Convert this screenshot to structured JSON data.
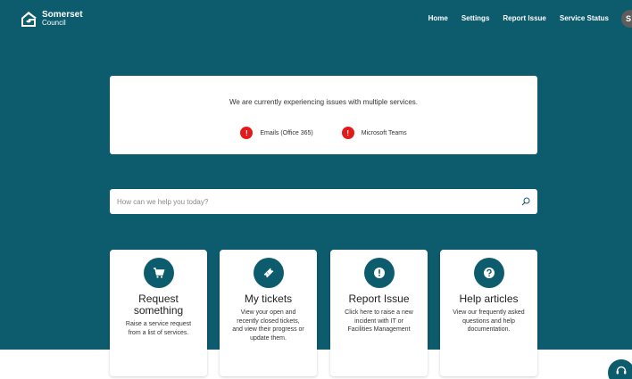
{
  "header": {
    "logo_name": "Somerset",
    "logo_sub": "Council",
    "nav": [
      "Home",
      "Settings",
      "Report Issue",
      "Service Status"
    ],
    "avatar_initials": "S"
  },
  "alert": {
    "message": "We are currently experiencing issues with multiple services.",
    "items": [
      {
        "icon": "!",
        "label": "Emails (Office 365)"
      },
      {
        "icon": "!",
        "label": "Microsoft Teams"
      }
    ]
  },
  "search": {
    "placeholder": "How can we help you today?",
    "value": ""
  },
  "cards": [
    {
      "title": "Request something",
      "desc": "Raise a service request from a list of services.",
      "icon": "cart-icon"
    },
    {
      "title": "My tickets",
      "desc": "View your open and recently closed tickets, and view their progress or update them.",
      "icon": "ticket-icon"
    },
    {
      "title": "Report Issue",
      "desc": "Click here to raise a new incident with IT or Facilities Management",
      "icon": "exclamation-icon"
    },
    {
      "title": "Help articles",
      "desc": "View our frequently asked questions and help documentation.",
      "icon": "question-icon"
    }
  ],
  "colors": {
    "brand": "#0d5c6e",
    "alert": "#e21a1a"
  }
}
